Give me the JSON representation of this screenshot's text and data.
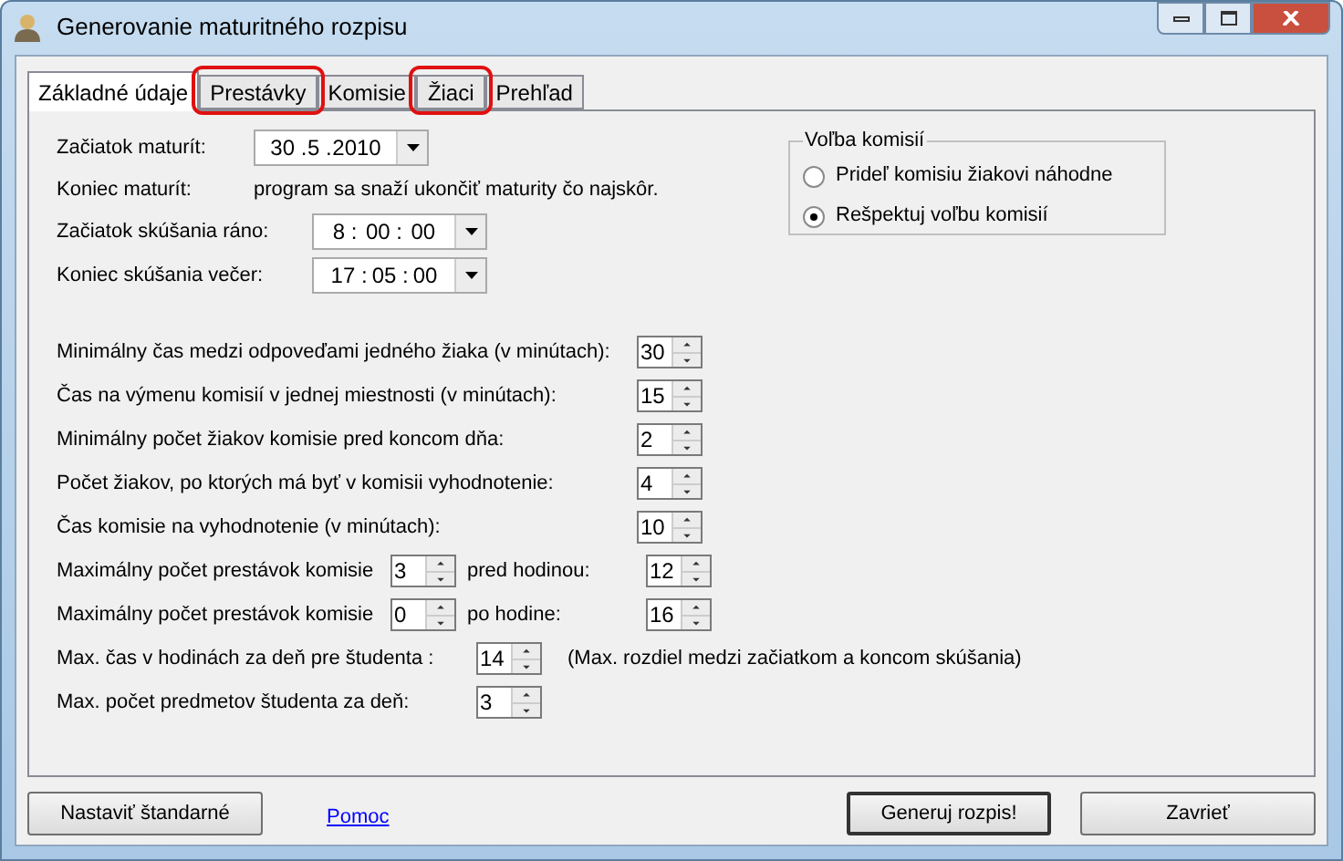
{
  "window": {
    "title": "Generovanie maturitného rozpisu"
  },
  "tabs": [
    {
      "label": "Základné údaje",
      "selected": true,
      "highlighted": false
    },
    {
      "label": "Prestávky",
      "selected": false,
      "highlighted": true
    },
    {
      "label": "Komisie",
      "selected": false,
      "highlighted": false
    },
    {
      "label": "Žiaci",
      "selected": false,
      "highlighted": true
    },
    {
      "label": "Prehľad",
      "selected": false,
      "highlighted": false
    }
  ],
  "dates": [
    {
      "kind": "date",
      "label": "Začiatok maturít:",
      "parts": [
        "30 .",
        "5 .",
        "2010"
      ]
    },
    {
      "kind": "text",
      "label": "Koniec maturít:",
      "value": "program sa snaží ukončiť maturity čo najskôr."
    },
    {
      "kind": "time",
      "label": "Začiatok skúšania ráno:",
      "parts": [
        "8 :",
        "00 :",
        "00"
      ]
    },
    {
      "kind": "time",
      "label": "Koniec skúšania večer:",
      "parts": [
        "17 :",
        "05 :",
        "00"
      ]
    }
  ],
  "committee_choice": {
    "title": "Voľba komisií",
    "options": [
      {
        "label": "Prideľ komisiu žiakovi náhodne",
        "selected": false
      },
      {
        "label": "Rešpektuj voľbu komisií",
        "selected": true
      }
    ]
  },
  "settings": [
    {
      "kind": "wide",
      "label": "Minimálny čas medzi odpoveďami jedného žiaka (v minútach):",
      "value": "30"
    },
    {
      "kind": "wide",
      "label": "Čas na výmenu komisií v jednej miestnosti (v minútach):",
      "value": "15"
    },
    {
      "kind": "wide",
      "label": "Minimálny počet žiakov komisie pred koncom dňa:",
      "value": "2"
    },
    {
      "kind": "wide",
      "label": "Počet žiakov, po ktorých má byť v komisii vyhodnotenie:",
      "value": "4"
    },
    {
      "kind": "wide",
      "label": "Čas komisie na vyhodnotenie (v minútach):",
      "value": "10"
    },
    {
      "kind": "pair",
      "label": "Maximálny počet prestávok komisie",
      "value": "3",
      "label2": "pred hodinou:",
      "value2": "12"
    },
    {
      "kind": "pair",
      "label": "Maximálny počet prestávok komisie",
      "value": "0",
      "label2": "po hodine:",
      "value2": "16"
    },
    {
      "kind": "short",
      "label": "Max. čas v hodinách za deň pre študenta :",
      "value": "14",
      "note": "(Max. rozdiel medzi začiatkom a koncom skúšania)"
    },
    {
      "kind": "short",
      "label": "Max. počet predmetov študenta za deň:",
      "value": "3"
    }
  ],
  "buttons": [
    {
      "kind": "button",
      "label": "Nastaviť štandarné"
    },
    {
      "kind": "link",
      "label": "Pomoc"
    },
    {
      "kind": "default",
      "label": "Generuj rozpis!"
    },
    {
      "kind": "button",
      "label": "Zavrieť"
    }
  ]
}
